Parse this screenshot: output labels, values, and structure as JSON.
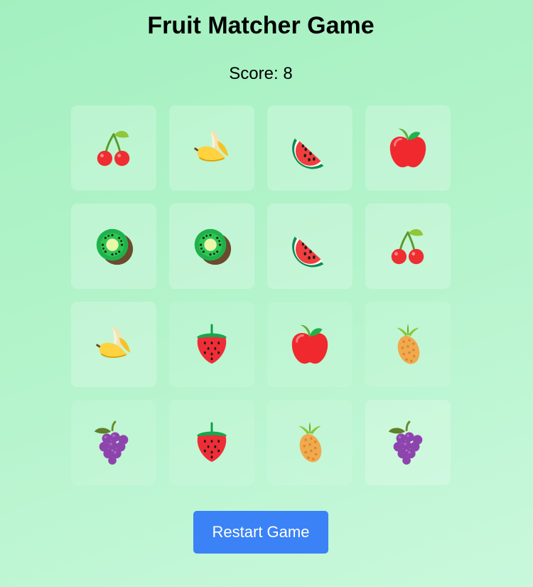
{
  "header": {
    "title": "Fruit Matcher Game",
    "score_label": "Score: 8"
  },
  "board": {
    "rows": 4,
    "columns": 4,
    "cards": [
      {
        "fruit": "cherries",
        "state": "open"
      },
      {
        "fruit": "banana",
        "state": "open"
      },
      {
        "fruit": "watermelon",
        "state": "open"
      },
      {
        "fruit": "apple",
        "state": "open"
      },
      {
        "fruit": "kiwi",
        "state": "open"
      },
      {
        "fruit": "kiwi",
        "state": "open"
      },
      {
        "fruit": "watermelon",
        "state": "open"
      },
      {
        "fruit": "cherries",
        "state": "open"
      },
      {
        "fruit": "banana",
        "state": "open"
      },
      {
        "fruit": "strawberry",
        "state": "matched"
      },
      {
        "fruit": "apple",
        "state": "matched"
      },
      {
        "fruit": "pineapple",
        "state": "matched"
      },
      {
        "fruit": "grapes",
        "state": "matched"
      },
      {
        "fruit": "strawberry",
        "state": "matched"
      },
      {
        "fruit": "pineapple",
        "state": "matched"
      },
      {
        "fruit": "grapes",
        "state": "open"
      }
    ]
  },
  "actions": {
    "restart_label": "Restart Game"
  },
  "colors": {
    "button": "#3b82f6",
    "background_start": "#a3f0bf",
    "background_end": "#c9f8dc"
  }
}
